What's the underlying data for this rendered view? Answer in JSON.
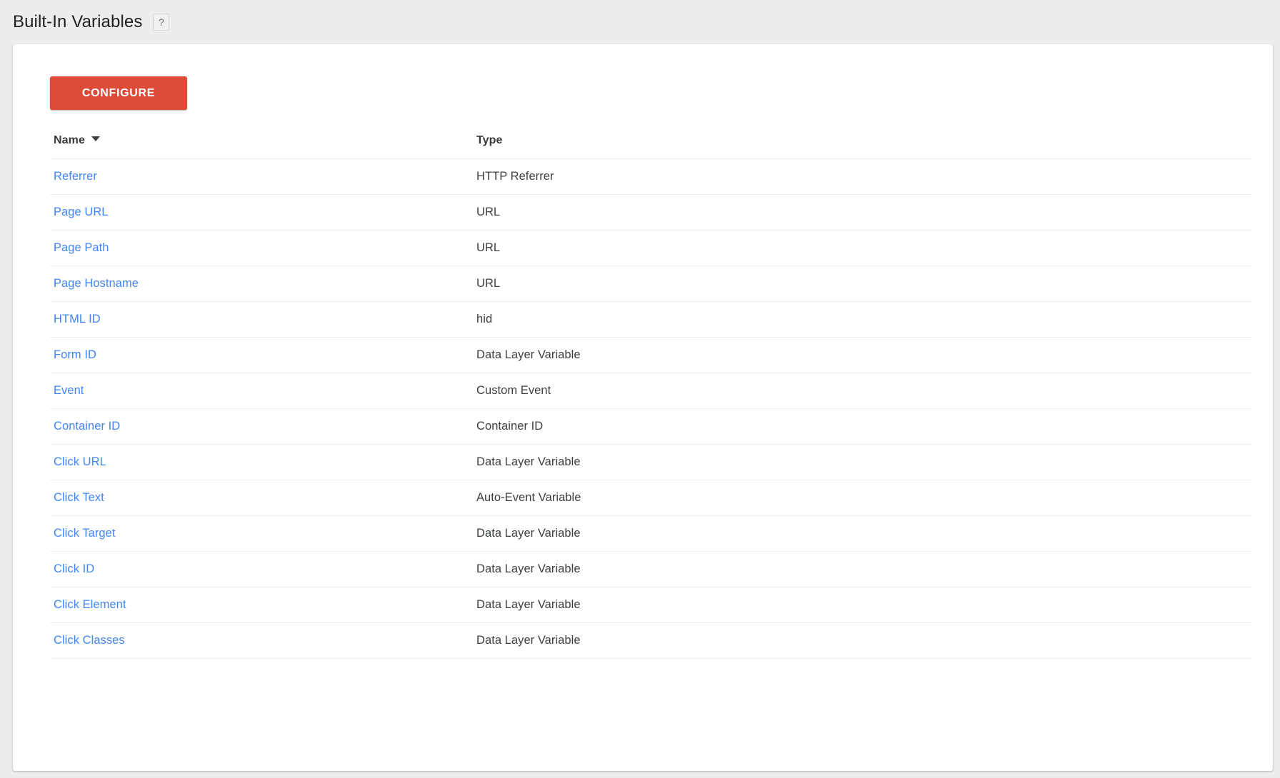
{
  "header": {
    "title": "Built-In Variables",
    "help_icon": "help-question-icon",
    "help_label": "?"
  },
  "toolbar": {
    "configure_label": "CONFIGURE"
  },
  "table": {
    "columns": [
      {
        "label": "Name",
        "sorted": true,
        "sort_direction": "descending",
        "sort_icon": "caret-down-icon"
      },
      {
        "label": "Type",
        "sorted": false
      }
    ],
    "rows": [
      {
        "name": "Referrer",
        "type": "HTTP Referrer"
      },
      {
        "name": "Page URL",
        "type": "URL"
      },
      {
        "name": "Page Path",
        "type": "URL"
      },
      {
        "name": "Page Hostname",
        "type": "URL"
      },
      {
        "name": "HTML ID",
        "type": "hid"
      },
      {
        "name": "Form ID",
        "type": "Data Layer Variable"
      },
      {
        "name": "Event",
        "type": "Custom Event"
      },
      {
        "name": "Container ID",
        "type": "Container ID"
      },
      {
        "name": "Click URL",
        "type": "Data Layer Variable"
      },
      {
        "name": "Click Text",
        "type": "Auto-Event Variable"
      },
      {
        "name": "Click Target",
        "type": "Data Layer Variable"
      },
      {
        "name": "Click ID",
        "type": "Data Layer Variable"
      },
      {
        "name": "Click Element",
        "type": "Data Layer Variable"
      },
      {
        "name": "Click Classes",
        "type": "Data Layer Variable"
      }
    ]
  },
  "colors": {
    "accent_button": "#dd4b39",
    "link": "#4285f4",
    "page_background": "#ededed",
    "card_background": "#ffffff",
    "divider": "#eceff1",
    "text_primary": "#212121",
    "text_secondary": "#3c4043"
  }
}
